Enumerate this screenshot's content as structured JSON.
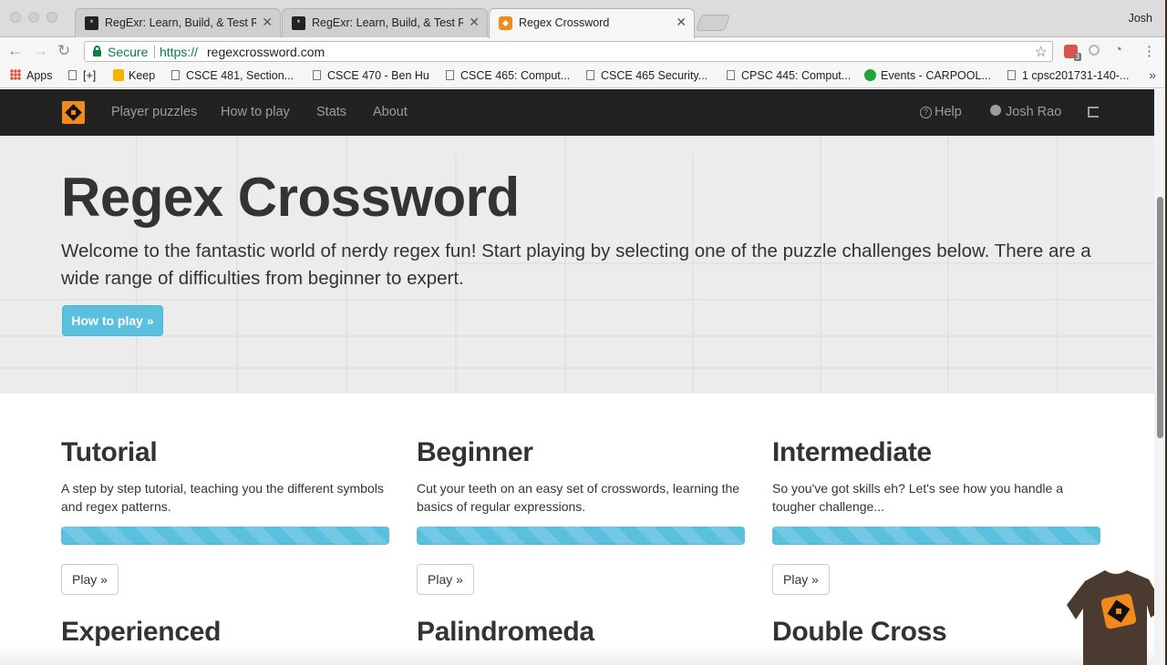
{
  "browser": {
    "profile_name": "Josh",
    "tabs": [
      {
        "title": "RegExr: Learn, Build, & Test RegEx",
        "active": false
      },
      {
        "title": "RegExr: Learn, Build, & Test RegEx",
        "active": false
      },
      {
        "title": "Regex Crossword",
        "active": true
      }
    ],
    "address": {
      "security_label": "Secure",
      "scheme": "https://",
      "host": "regexcrossword.com"
    },
    "extension_badge": "3",
    "bookmarks": [
      {
        "label": "Apps",
        "icon": "apps-grid-icon"
      },
      {
        "label": "[+]",
        "icon": "page-icon"
      },
      {
        "label": "Keep",
        "icon": "keep-icon"
      },
      {
        "label": "CSCE 481, Section...",
        "icon": "page-icon"
      },
      {
        "label": "CSCE 470 - Ben Hu",
        "icon": "page-icon"
      },
      {
        "label": "CSCE 465: Comput...",
        "icon": "page-icon"
      },
      {
        "label": "CSCE 465 Security...",
        "icon": "page-icon"
      },
      {
        "label": "CPSC 445: Comput...",
        "icon": "page-icon"
      },
      {
        "label": "Events - CARPOOL...",
        "icon": "events-icon"
      },
      {
        "label": "1 cpsc201731-140-...",
        "icon": "page-icon"
      }
    ],
    "bookmarks_overflow": "»"
  },
  "site_nav": {
    "links": [
      "Player puzzles",
      "How to play",
      "Stats",
      "About"
    ],
    "help_label": "Help",
    "user_name": "Josh Rao"
  },
  "hero": {
    "title": "Regex Crossword",
    "text": "Welcome to the fantastic world of nerdy regex fun! Start playing by selecting one of the puzzle challenges below. There are a wide range of difficulties from beginner to expert.",
    "button_label": "How to play »"
  },
  "challenges": [
    {
      "title": "Tutorial",
      "description": "A step by step tutorial, teaching you the different symbols and regex patterns.",
      "progress": 1.0,
      "button_label": "Play »"
    },
    {
      "title": "Beginner",
      "description": "Cut your teeth on an easy set of crosswords, learning the basics of regular expressions.",
      "progress": 1.0,
      "button_label": "Play »"
    },
    {
      "title": "Intermediate",
      "description": "So you've got skills eh? Let's see how you handle a tougher challenge...",
      "progress": 1.0,
      "button_label": "Play »"
    }
  ],
  "next_challenges": [
    "Experienced",
    "Palindromeda",
    "Double Cross"
  ],
  "colors": {
    "brand_orange": "#f08a1c",
    "navbar": "#222222",
    "info": "#5bc0de",
    "secure_green": "#0b8043"
  }
}
